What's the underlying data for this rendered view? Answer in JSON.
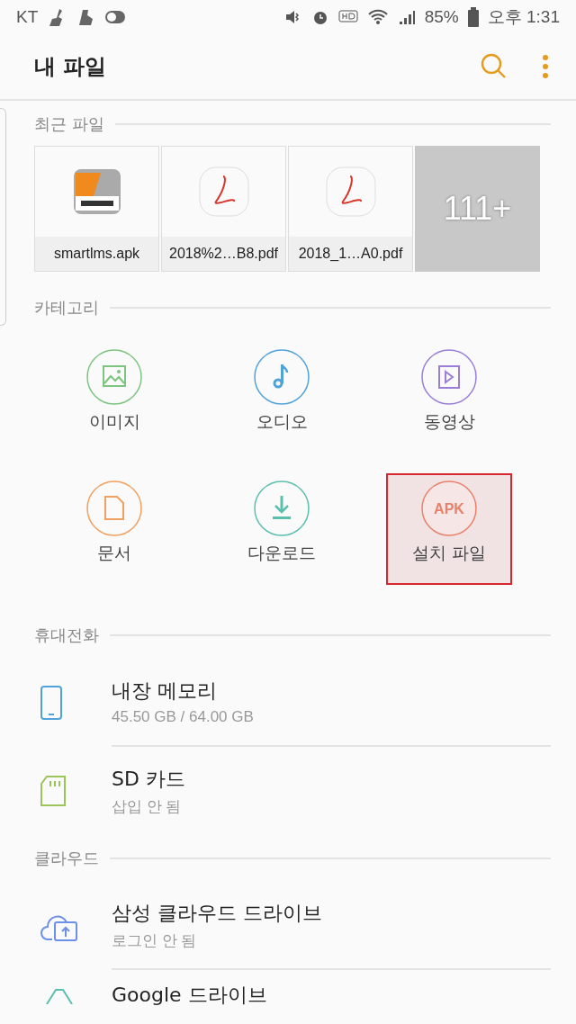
{
  "status_bar": {
    "carrier": "KT",
    "battery_text": "85%",
    "time": "오후 1:31"
  },
  "header": {
    "title": "내 파일"
  },
  "recent": {
    "title": "최근 파일",
    "files": [
      {
        "kind": "apk",
        "name": "smartlms.apk"
      },
      {
        "kind": "pdf",
        "name": "2018%2…B8.pdf"
      },
      {
        "kind": "pdf",
        "name": "2018_1…A0.pdf"
      }
    ],
    "more": {
      "count": "111+"
    }
  },
  "categories": {
    "title": "카테고리",
    "items": [
      {
        "kind": "image",
        "label": "이미지",
        "color": "#7cc47f",
        "selected": false
      },
      {
        "kind": "audio",
        "label": "오디오",
        "color": "#4fa3d9",
        "selected": false
      },
      {
        "kind": "video",
        "label": "동영상",
        "color": "#9a7ed8",
        "selected": false
      },
      {
        "kind": "document",
        "label": "문서",
        "color": "#f0a060",
        "selected": false
      },
      {
        "kind": "download",
        "label": "다운로드",
        "color": "#5bbfae",
        "selected": false
      },
      {
        "kind": "apk",
        "label": "설치 파일",
        "icon_text": "APK",
        "color": "#e8806a",
        "selected": true
      }
    ]
  },
  "phone": {
    "title": "휴대전화",
    "items": [
      {
        "kind": "phone",
        "name": "내장 메모리",
        "detail": "45.50 GB / 64.00 GB"
      },
      {
        "kind": "sd",
        "name": "SD 카드",
        "detail": "삽입 안 됨"
      }
    ]
  },
  "cloud": {
    "title": "클라우드",
    "items": [
      {
        "kind": "samsung",
        "name": "삼성 클라우드 드라이브",
        "detail": "로그인 안 됨"
      },
      {
        "kind": "google",
        "name": "Google 드라이브"
      }
    ]
  }
}
